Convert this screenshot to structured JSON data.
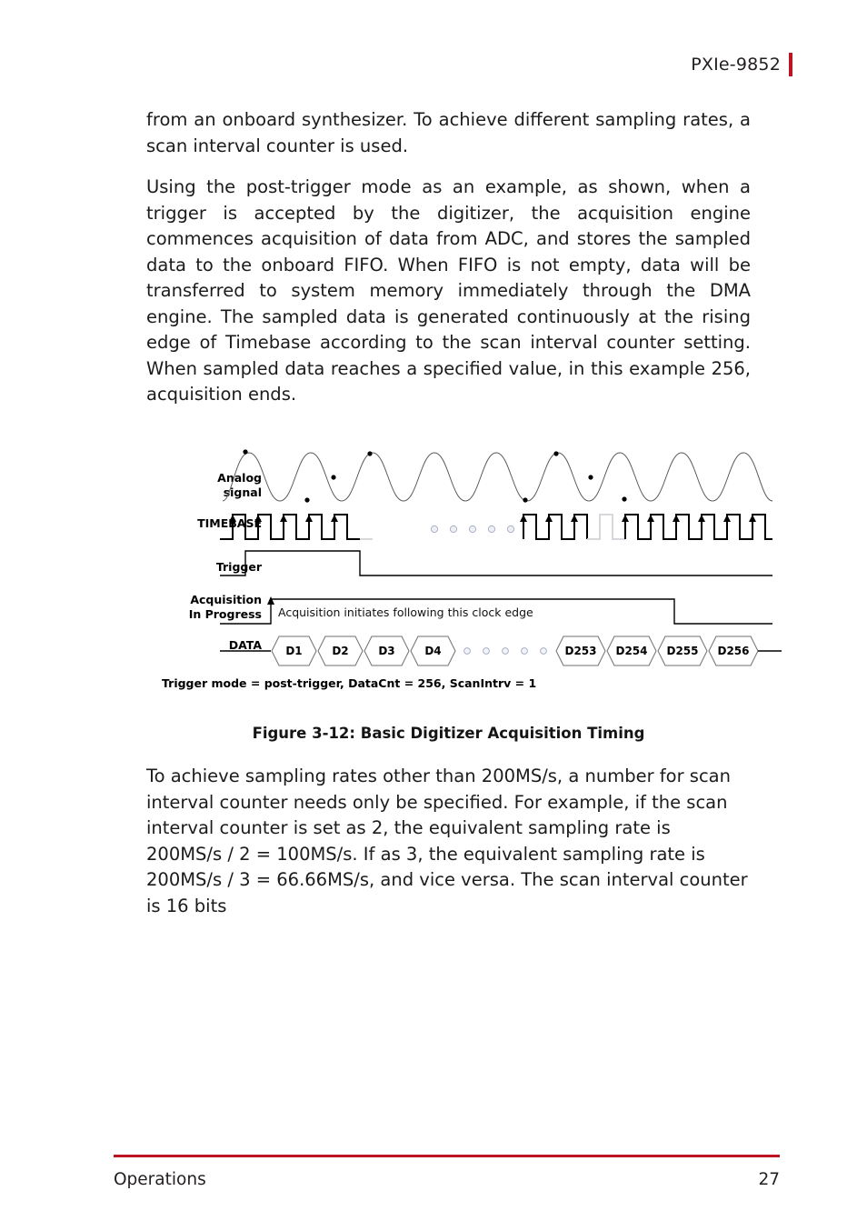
{
  "header": {
    "title": "PXIe-9852",
    "rule_color": "#bd1421"
  },
  "body": {
    "paragraph_1": "from an onboard synthesizer. To achieve different sampling rates, a scan interval counter is used.",
    "paragraph_2": "Using the post-trigger mode as an example, as shown, when a trigger is accepted by the digitizer, the acquisition engine commences acquisition of data from ADC, and stores the sampled data to the onboard FIFO. When FIFO is not empty, data will be transferred to system memory immediately through the DMA engine. The sampled data is generated continuously at the rising edge of Timebase according to the scan interval counter setting. When sampled data reaches a specified value, in this example 256, acquisition ends.",
    "paragraph_3": "To achieve sampling rates other than 200MS/s, a number for scan interval counter needs only be specified. For example, if the scan interval counter is set as 2, the equivalent sampling rate is 200MS/s / 2 = 100MS/s. If as 3, the equivalent sampling rate is 200MS/s / 3 = 66.66MS/s, and vice versa. The scan interval counter is 16 bits"
  },
  "figure": {
    "caption": "Figure 3-12: Basic Digitizer Acquisition Timing",
    "note": "Trigger mode = post-trigger, DataCnt = 256, ScanIntrv = 1",
    "annotation": "Acquisition initiates following this clock edge",
    "signals": {
      "analog_line1": "Analog",
      "analog_line2": "signal",
      "timebase": "TIMEBASE",
      "trigger": "Trigger",
      "acq_line1": "Acquisition",
      "acq_line2": "In Progress",
      "data": "DATA"
    },
    "data_cells_left": [
      "D1",
      "D2",
      "D3",
      "D4"
    ],
    "data_cells_right": [
      "D253",
      "D254",
      "D255",
      "D256"
    ],
    "ellipsis_count": 5,
    "colors": {
      "signal": "#000000",
      "analog_wave": "#5a5a5a",
      "ghost": "#d8d8dc",
      "dot": "#aab0c4"
    }
  },
  "footer": {
    "section": "Operations",
    "page_number": "27",
    "rule_color": "#bd1421"
  }
}
